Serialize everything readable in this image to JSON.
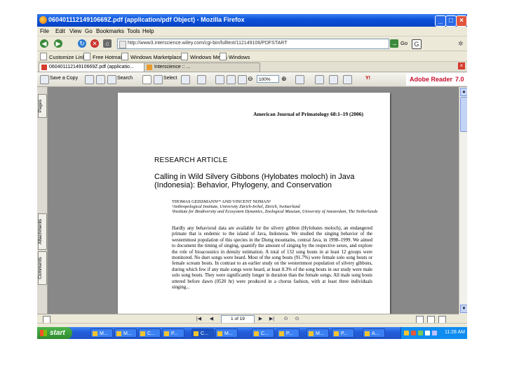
{
  "window": {
    "title": "06040111214910669Z.pdf (application/pdf Object) - Mozilla Firefox",
    "buttons": {
      "minimize": "_",
      "maximize": "□",
      "close": "×"
    }
  },
  "menu": [
    "File",
    "Edit",
    "View",
    "Go",
    "Bookmarks",
    "Tools",
    "Help"
  ],
  "nav": {
    "url": "http://www3.interscience.wiley.com/cgi-bin/fulltext/112149106/PDFSTART",
    "go_label": "Go"
  },
  "bookmarks": [
    "Customize Links",
    "Free Hotmail",
    "Windows Marketplace",
    "Windows Media",
    "Windows"
  ],
  "tabs": [
    {
      "label": "06040111214910669Z.pdf (applicatio..."
    },
    {
      "label": "Interscience :: ..."
    }
  ],
  "reader": {
    "save_copy": "Save a Copy",
    "search": "Search",
    "select": "Select",
    "zoom": "100%",
    "adobe": "Adobe Reader",
    "adobe_version": "7.0"
  },
  "sidepanel": {
    "pages": "Pages",
    "attachments": "Attachments",
    "comments": "Comments"
  },
  "document": {
    "journal": "American Journal of Primatology 68:1–19 (2006)",
    "section": "RESEARCH ARTICLE",
    "title": "Calling in Wild Silvery Gibbons (Hylobates moloch) in Java (Indonesia): Behavior, Phylogeny, and Conservation",
    "authors": "THOMAS GEISSMANN¹* AND VINCENT NIJMAN²",
    "affil1": "¹Anthropological Institute, University Zürich-Irchel, Zürich, Switzerland",
    "affil2": "²Institute for Biodiversity and Ecosystem Dynamics, Zoological Museum, University of Amsterdam, The Netherlands",
    "abstract": "Hardly any behavioral data are available for the silvery gibbon (Hylobates moloch), an endangered primate that is endemic to the island of Java, Indonesia. We studied the singing behavior of the westernmost population of this species in the Dieng mountains, central Java, in 1998–1999. We aimed to document the timing of singing, quantify the amount of singing by the respective sexes, and explore the role of bioacoustics in density estimation. A total of 132 song bouts in at least 12 groups were monitored. No duet songs were heard. Most of the song bouts (91.7%) were female solo song bouts or female scream bouts. In contrast to an earlier study on the westernmost population of silvery gibbons, during which few if any male songs were heard, at least 8.3% of the song bouts in our study were male solo song bouts. They were significantly longer in duration than the female songs. All male song bouts uttered before dawn (0520 hr) were produced in a chorus fashion, with at least three individuals singing..."
  },
  "pagenav": {
    "page": "1 of 19"
  },
  "taskbar": {
    "start": "start",
    "tasks": [
      "M...",
      "M...",
      "C...",
      "P...",
      "C...",
      "M...",
      "C...",
      "P...",
      "M...",
      "P...",
      "A..."
    ],
    "clock": "11:28 AM"
  }
}
